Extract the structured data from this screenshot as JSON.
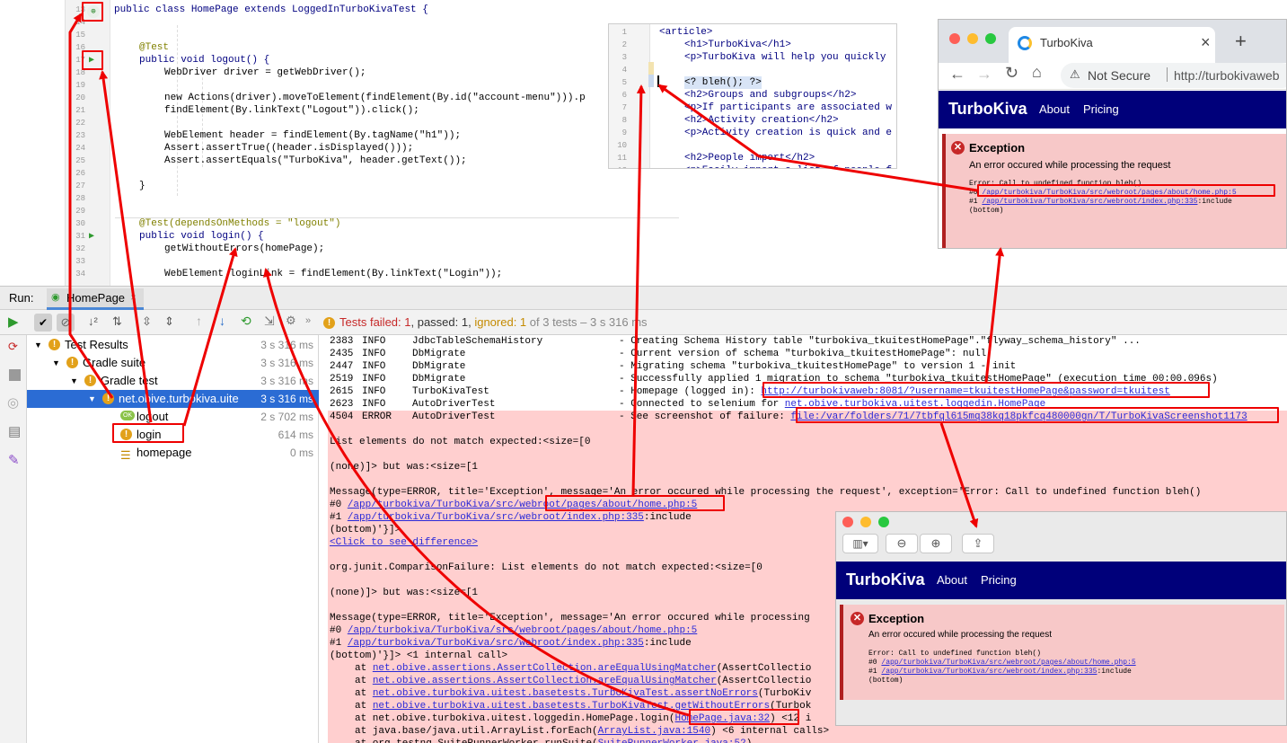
{
  "editor": {
    "lines": [
      {
        "n": "13",
        "code": "public class HomePage extends LoggedInTurboKivaTest {"
      },
      {
        "n": "14",
        "code": ""
      },
      {
        "n": "15",
        "code": ""
      },
      {
        "n": "16",
        "code": "@Test"
      },
      {
        "n": "17",
        "code": "public void logout() {"
      },
      {
        "n": "18",
        "code": "WebDriver driver = getWebDriver();"
      },
      {
        "n": "19",
        "code": ""
      },
      {
        "n": "20",
        "code": "new Actions(driver).moveToElement(findElement(By.id(\"account-menu\"))).p"
      },
      {
        "n": "21",
        "code": "findElement(By.linkText(\"Logout\")).click();"
      },
      {
        "n": "22",
        "code": ""
      },
      {
        "n": "23",
        "code": "WebElement header = findElement(By.tagName(\"h1\"));"
      },
      {
        "n": "24",
        "code": "Assert.assertTrue((header.isDisplayed()));"
      },
      {
        "n": "25",
        "code": "Assert.assertEquals(\"TurboKiva\", header.getText());"
      },
      {
        "n": "26",
        "code": ""
      },
      {
        "n": "27",
        "code": "}"
      },
      {
        "n": "28",
        "code": ""
      },
      {
        "n": "29",
        "code": ""
      },
      {
        "n": "30",
        "code": "@Test(dependsOnMethods = \"logout\")"
      },
      {
        "n": "31",
        "code": "public void login() {"
      },
      {
        "n": "32",
        "code": "getWithoutErrors(homePage);"
      },
      {
        "n": "33",
        "code": ""
      },
      {
        "n": "34",
        "code": "WebElement loginLink = findElement(By.linkText(\"Login\"));"
      }
    ]
  },
  "html_editor": {
    "lines": [
      {
        "n": "1",
        "code": "<article>"
      },
      {
        "n": "2",
        "code": "<h1>TurboKiva</h1>"
      },
      {
        "n": "3",
        "code": "<p>TurboKiva will help you quickly"
      },
      {
        "n": "4",
        "code": ""
      },
      {
        "n": "5",
        "code": "<? bleh(); ?>"
      },
      {
        "n": "6",
        "code": "<h2>Groups and subgroups</h2>"
      },
      {
        "n": "7",
        "code": "<p>If participants are associated w"
      },
      {
        "n": "8",
        "code": "<h2>Activity creation</h2>"
      },
      {
        "n": "9",
        "code": "<p>Activity creation is quick and e"
      },
      {
        "n": "10",
        "code": ""
      },
      {
        "n": "11",
        "code": "<h2>People import</h2>"
      },
      {
        "n": "12",
        "code": "<p>Easily import a list of people f"
      }
    ]
  },
  "chrome": {
    "tab_title": "TurboKiva",
    "close_label": "×",
    "new_tab_label": "+",
    "not_secure": "Not Secure",
    "url": "http://turbokivaweb",
    "brand": "TurboKiva",
    "nav": [
      "About",
      "Pricing"
    ],
    "exception_title": "Exception",
    "exception_msg": "An error occured while processing the request",
    "trace0": "Error: Call to undefined function bleh()",
    "trace1_prefix": "#0 ",
    "trace1_link": "/app/turbokiva/TurboKiva/src/webroot/pages/about/home.php:5",
    "trace2_prefix": "#1 ",
    "trace2_link": "/app/turbokiva/TurboKiva/src/webroot/index.php:335",
    "trace2_suffix": ":include",
    "trace3": "(bottom)"
  },
  "viewer": {
    "brand": "TurboKiva",
    "nav": [
      "About",
      "Pricing"
    ],
    "exception_title": "Exception",
    "exception_msg": "An error occured while processing the request",
    "trace0": "Error: Call to undefined function bleh()",
    "trace1_prefix": "#0 ",
    "trace1_link": "/app/turbokiva/TurboKiva/src/webroot/pages/about/home.php:5",
    "trace2_prefix": "#1 ",
    "trace2_link": "/app/turbokiva/TurboKiva/src/webroot/index.php:335",
    "trace2_suffix": ":include",
    "trace3": "(bottom)"
  },
  "run": {
    "label": "Run:",
    "tab": "HomePage",
    "status_failed": "Tests failed: 1",
    "status_passed": ", passed: 1, ",
    "status_ignored": "ignored: 1",
    "status_rest": " of 3 tests – 3 s 316 ms",
    "tree": [
      {
        "label": "Test Results",
        "time": "3 s 316 ms",
        "level": 0,
        "icon": "warn"
      },
      {
        "label": "Gradle suite",
        "time": "3 s 316 ms",
        "level": 1,
        "icon": "warn"
      },
      {
        "label": "Gradle test",
        "time": "3 s 316 ms",
        "level": 2,
        "icon": "warn"
      },
      {
        "label": "net.obive.turbokiva.uite",
        "time": "3 s 316 ms",
        "level": 3,
        "icon": "warn",
        "selected": true
      },
      {
        "label": "logout",
        "time": "2 s 702 ms",
        "level": 4,
        "icon": "ok"
      },
      {
        "label": "login",
        "time": "614 ms",
        "level": 4,
        "icon": "warn"
      },
      {
        "label": "homepage",
        "time": "0 ms",
        "level": 4,
        "icon": "ignored"
      }
    ]
  },
  "console": {
    "log": [
      {
        "t": "2383",
        "lvl": "INFO",
        "src": "JdbcTableSchemaHistory",
        "msg": "- Creating Schema History table \"turbokiva_tkuitestHomePage\".\"flyway_schema_history\" ..."
      },
      {
        "t": "2435",
        "lvl": "INFO",
        "src": "DbMigrate",
        "msg": "- Current version of schema \"turbokiva_tkuitestHomePage\": null"
      },
      {
        "t": "2447",
        "lvl": "INFO",
        "src": "DbMigrate",
        "msg": "- Migrating schema \"turbokiva_tkuitestHomePage\" to version 1 - init"
      },
      {
        "t": "2519",
        "lvl": "INFO",
        "src": "DbMigrate",
        "msg": "- Successfully applied 1 migration to schema \"turbokiva_tkuitestHomePage\" (execution time 00:00.096s)"
      },
      {
        "t": "2615",
        "lvl": "INFO",
        "src": "TurboKivaTest",
        "msg": "- Homepage (logged in): ",
        "link": "http://turbokivaweb:8081/?username=tkuitestHomePage&password=tkuitest"
      },
      {
        "t": "2623",
        "lvl": "INFO",
        "src": "AutoDriverTest",
        "msg": "- Connected to selenium for ",
        "link": "net.obive.turbokiva.uitest.loggedin.HomePage"
      },
      {
        "t": "4504",
        "lvl": "ERROR",
        "src": "AutoDriverTest",
        "msg": "- See screenshot of failure: ",
        "link": "file:/var/folders/71/7tbfql615mq38kq18pkfcq480000gn/T/TurboKivaScreenshot1173"
      }
    ],
    "fail1": "List elements do not match expected:<size=[0",
    "fail2": "(none)]> but was:<size=[1",
    "msg_line": "Message(type=ERROR, title='Exception', message='An error occured while processing the request', exception='Error: Call to undefined function bleh()",
    "msg_line_short": "Message(type=ERROR, title='Exception', message='An error occured while processing",
    "hash0": "#0 ",
    "hash0_link": "/app/turbokiva/TurboKiva/src/webroot/pages/about/home.php:5",
    "hash1": "#1 ",
    "hash1_link": "/app/turbokiva/TurboKiva/src/webroot/index.php:335",
    "hash1_suffix": ":include",
    "bottom1": "(bottom)'}]>",
    "bottom2": "(bottom)'}]> ",
    "internal": "<1 internal call>",
    "click_diff": "<Click to see difference>",
    "comparison": "org.junit.ComparisonFailure: List elements do not match expected:<size=[0",
    "stack": [
      {
        "pre": "at ",
        "link": "net.obive.assertions.AssertCollection.areEqualUsingMatcher",
        "post": "(AssertCollectio"
      },
      {
        "pre": "at ",
        "link": "net.obive.assertions.AssertCollection.areEqualUsingMatcher",
        "post": "(AssertCollectio"
      },
      {
        "pre": "at ",
        "link": "net.obive.turbokiva.uitest.basetests.TurboKivaTest.assertNoErrors",
        "post": "(TurboKiv"
      },
      {
        "pre": "at ",
        "link": "net.obive.turbokiva.uitest.basetests.TurboKivaTest.getWithoutErrors",
        "post": "(Turbok"
      },
      {
        "pre": "at net.obive.turbokiva.uitest.loggedin.HomePage.login(",
        "link": "HomePage.java:32",
        "post": ") <12 i"
      },
      {
        "pre": "at java.base/java.util.ArrayList.forEach(",
        "link": "ArrayList.java:1540",
        "post": ") <6 internal calls>"
      },
      {
        "pre": "at org.testng.SuiteRunnerWorker.runSuite(",
        "link": "SuiteRunnerWorker.java:52",
        "post": ")"
      }
    ]
  }
}
